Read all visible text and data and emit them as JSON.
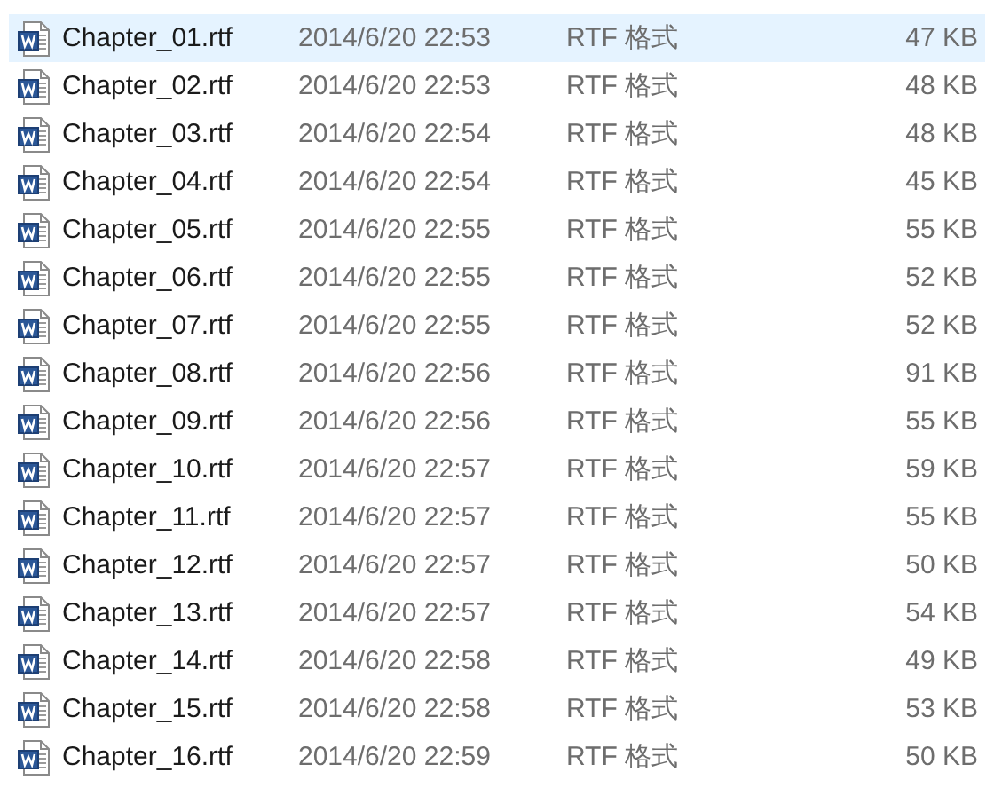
{
  "files": [
    {
      "name": "Chapter_01.rtf",
      "modified": "2014/6/20 22:53",
      "type": "RTF 格式",
      "size": "47 KB",
      "selected": true
    },
    {
      "name": "Chapter_02.rtf",
      "modified": "2014/6/20 22:53",
      "type": "RTF 格式",
      "size": "48 KB",
      "selected": false
    },
    {
      "name": "Chapter_03.rtf",
      "modified": "2014/6/20 22:54",
      "type": "RTF 格式",
      "size": "48 KB",
      "selected": false
    },
    {
      "name": "Chapter_04.rtf",
      "modified": "2014/6/20 22:54",
      "type": "RTF 格式",
      "size": "45 KB",
      "selected": false
    },
    {
      "name": "Chapter_05.rtf",
      "modified": "2014/6/20 22:55",
      "type": "RTF 格式",
      "size": "55 KB",
      "selected": false
    },
    {
      "name": "Chapter_06.rtf",
      "modified": "2014/6/20 22:55",
      "type": "RTF 格式",
      "size": "52 KB",
      "selected": false
    },
    {
      "name": "Chapter_07.rtf",
      "modified": "2014/6/20 22:55",
      "type": "RTF 格式",
      "size": "52 KB",
      "selected": false
    },
    {
      "name": "Chapter_08.rtf",
      "modified": "2014/6/20 22:56",
      "type": "RTF 格式",
      "size": "91 KB",
      "selected": false
    },
    {
      "name": "Chapter_09.rtf",
      "modified": "2014/6/20 22:56",
      "type": "RTF 格式",
      "size": "55 KB",
      "selected": false
    },
    {
      "name": "Chapter_10.rtf",
      "modified": "2014/6/20 22:57",
      "type": "RTF 格式",
      "size": "59 KB",
      "selected": false
    },
    {
      "name": "Chapter_11.rtf",
      "modified": "2014/6/20 22:57",
      "type": "RTF 格式",
      "size": "55 KB",
      "selected": false
    },
    {
      "name": "Chapter_12.rtf",
      "modified": "2014/6/20 22:57",
      "type": "RTF 格式",
      "size": "50 KB",
      "selected": false
    },
    {
      "name": "Chapter_13.rtf",
      "modified": "2014/6/20 22:57",
      "type": "RTF 格式",
      "size": "54 KB",
      "selected": false
    },
    {
      "name": "Chapter_14.rtf",
      "modified": "2014/6/20 22:58",
      "type": "RTF 格式",
      "size": "49 KB",
      "selected": false
    },
    {
      "name": "Chapter_15.rtf",
      "modified": "2014/6/20 22:58",
      "type": "RTF 格式",
      "size": "53 KB",
      "selected": false
    },
    {
      "name": "Chapter_16.rtf",
      "modified": "2014/6/20 22:59",
      "type": "RTF 格式",
      "size": "50 KB",
      "selected": false
    }
  ]
}
